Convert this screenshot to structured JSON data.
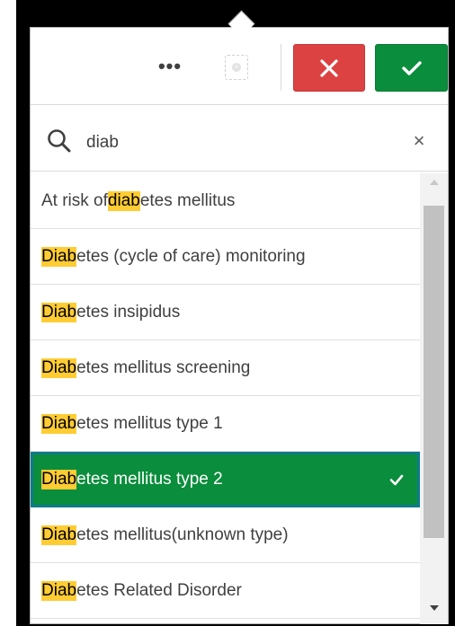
{
  "toolbar": {
    "more_label": "•••",
    "cancel_icon": "close-icon",
    "confirm_icon": "check-icon",
    "colors": {
      "cancel": "#dc4242",
      "confirm": "#0a8d3c"
    }
  },
  "search": {
    "value": "diab",
    "clear_label": "×"
  },
  "list": {
    "items": [
      {
        "pre": "At risk of ",
        "match": "diab",
        "post": "etes mellitus",
        "selected": false
      },
      {
        "pre": "",
        "match": "Diab",
        "post": "etes (cycle of care) monitoring",
        "selected": false
      },
      {
        "pre": "",
        "match": "Diab",
        "post": "etes insipidus",
        "selected": false
      },
      {
        "pre": "",
        "match": "Diab",
        "post": "etes mellitus screening",
        "selected": false
      },
      {
        "pre": "",
        "match": "Diab",
        "post": "etes mellitus type 1",
        "selected": false
      },
      {
        "pre": "",
        "match": "Diab",
        "post": "etes mellitus type 2",
        "selected": true
      },
      {
        "pre": "",
        "match": "Diab",
        "post": "etes mellitus(unknown type)",
        "selected": false
      },
      {
        "pre": "",
        "match": "Diab",
        "post": "etes Related Disorder",
        "selected": false
      }
    ],
    "highlight_color": "#ffcc33",
    "selected_color": "#0a8d3c"
  }
}
